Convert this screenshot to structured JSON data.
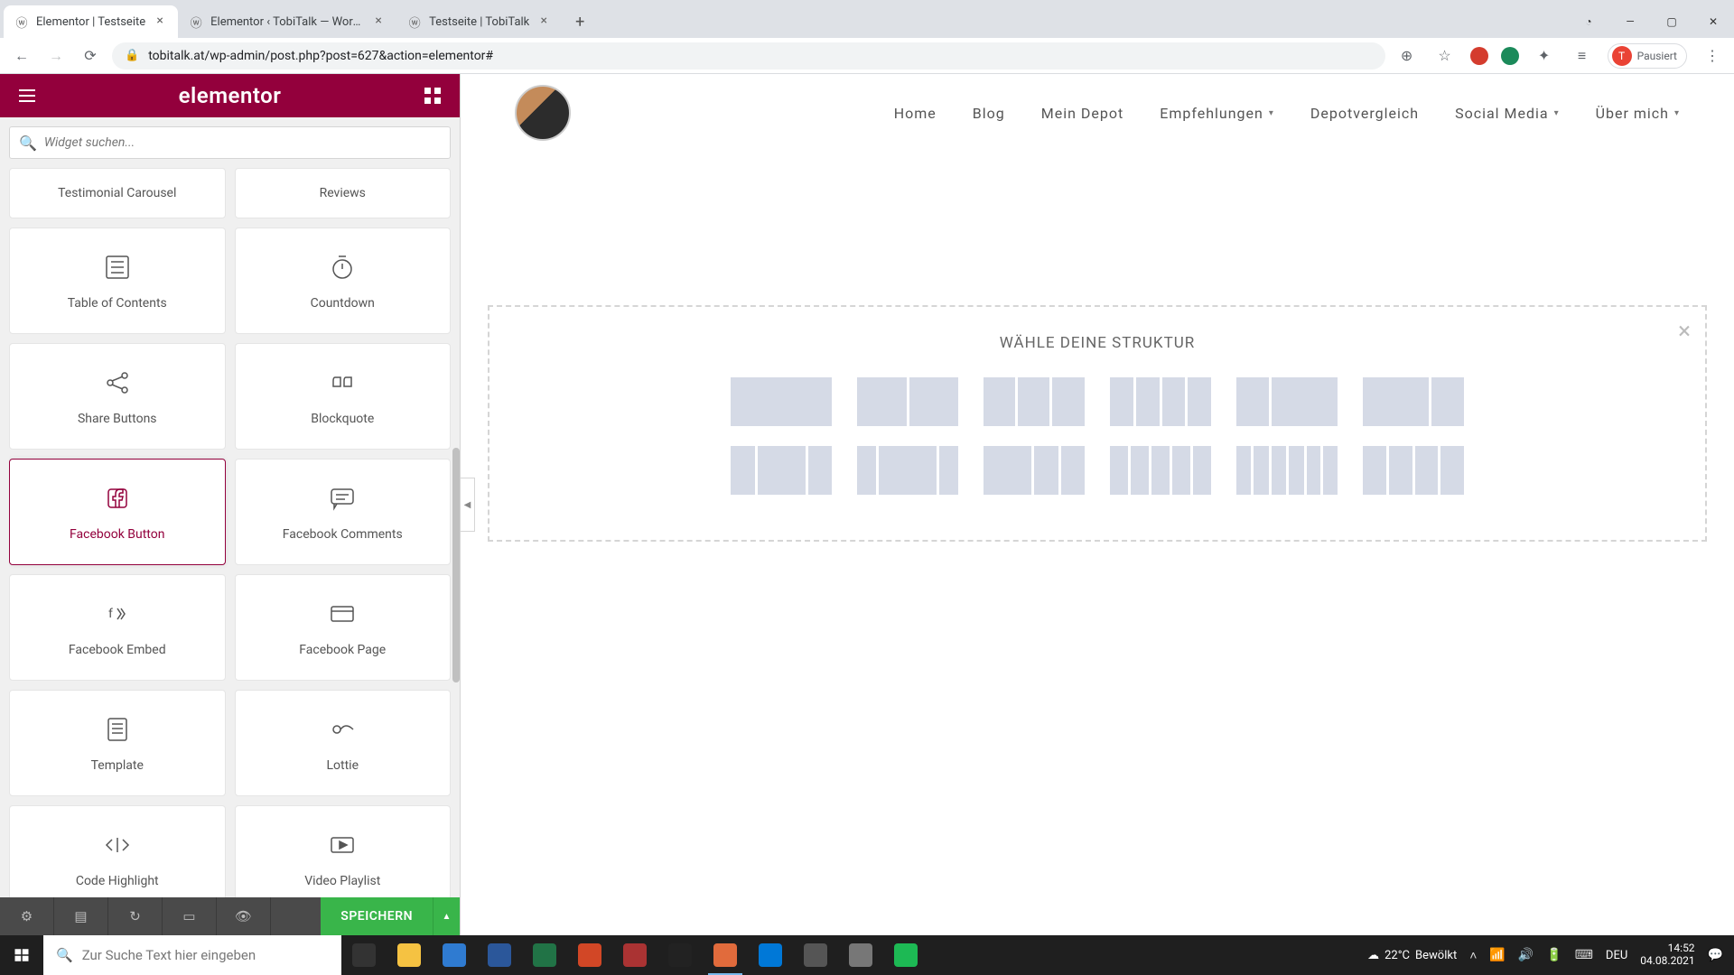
{
  "browser": {
    "tabs": [
      {
        "title": "Elementor | Testseite",
        "active": true
      },
      {
        "title": "Elementor ‹ TobiTalk — WordPre",
        "active": false
      },
      {
        "title": "Testseite | TobiTalk",
        "active": false
      }
    ],
    "url": "tobitalk.at/wp-admin/post.php?post=627&action=elementor#",
    "profile_label": "Pausiert",
    "profile_initial": "T"
  },
  "editor": {
    "brand": "elementor",
    "search_placeholder": "Widget suchen...",
    "widgets": [
      [
        "Testimonial Carousel",
        "Reviews"
      ],
      [
        "Table of Contents",
        "Countdown"
      ],
      [
        "Share Buttons",
        "Blockquote"
      ],
      [
        "Facebook Button",
        "Facebook Comments"
      ],
      [
        "Facebook Embed",
        "Facebook Page"
      ],
      [
        "Template",
        "Lottie"
      ],
      [
        "Code Highlight",
        "Video Playlist"
      ]
    ],
    "hover_widget": "Facebook Button",
    "save_label": "SPEICHERN"
  },
  "site": {
    "menu": [
      {
        "label": "Home",
        "dropdown": false
      },
      {
        "label": "Blog",
        "dropdown": false
      },
      {
        "label": "Mein Depot",
        "dropdown": false
      },
      {
        "label": "Empfehlungen",
        "dropdown": true
      },
      {
        "label": "Depotvergleich",
        "dropdown": false
      },
      {
        "label": "Social Media",
        "dropdown": true
      },
      {
        "label": "Über mich",
        "dropdown": true
      }
    ],
    "structure_title": "WÄHLE DEINE STRUKTUR",
    "structures_row1": [
      [
        100
      ],
      [
        50,
        50
      ],
      [
        33,
        33,
        34
      ],
      [
        25,
        25,
        25,
        25
      ],
      [
        33,
        67
      ],
      [
        67,
        33
      ]
    ],
    "structures_row2": [
      [
        25,
        50,
        25
      ],
      [
        20,
        60,
        20
      ],
      [
        50,
        25,
        25
      ],
      [
        20,
        20,
        20,
        20,
        20
      ],
      [
        17,
        17,
        17,
        17,
        16,
        16
      ],
      [
        25,
        25,
        25,
        25
      ]
    ]
  },
  "taskbar": {
    "search_placeholder": "Zur Suche Text hier eingeben",
    "weather_temp": "22°C",
    "weather_text": "Bewölkt",
    "lang": "DEU",
    "time": "14:52",
    "date": "04.08.2021"
  }
}
